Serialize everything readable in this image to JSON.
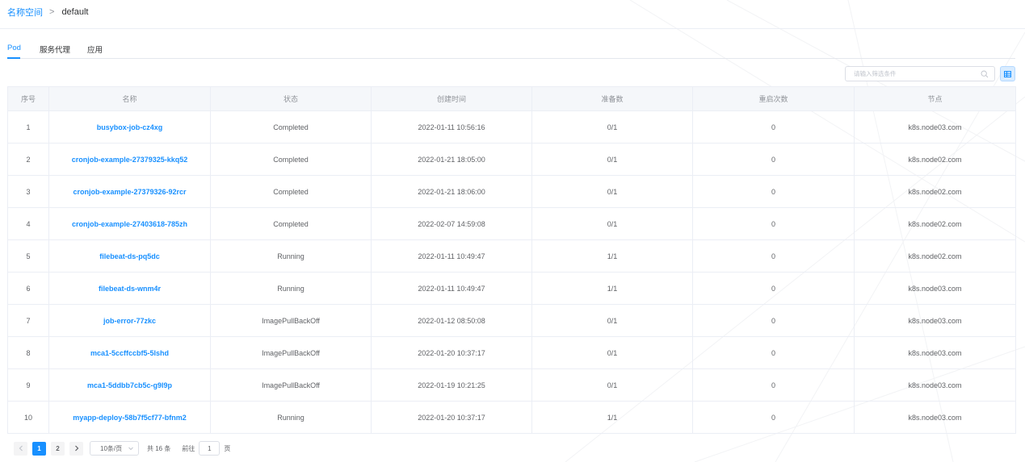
{
  "breadcrumb": {
    "root": "名称空间",
    "separator": ">",
    "current": "default"
  },
  "tabs": [
    {
      "label": "Pod",
      "active": true
    },
    {
      "label": "服务代理",
      "active": false
    },
    {
      "label": "应用",
      "active": false
    }
  ],
  "search": {
    "placeholder": "请输入筛选条件",
    "value": ""
  },
  "colors": {
    "accent": "#1890ff",
    "header_bg": "#f5f7fa",
    "border": "#ebeef5"
  },
  "table": {
    "columns": [
      "序号",
      "名称",
      "状态",
      "创建时间",
      "准备数",
      "重启次数",
      "节点"
    ],
    "rows": [
      [
        "1",
        "busybox-job-cz4xg",
        "Completed",
        "2022-01-11 10:56:16",
        "0/1",
        "0",
        "k8s.node03.com"
      ],
      [
        "2",
        "cronjob-example-27379325-kkq52",
        "Completed",
        "2022-01-21 18:05:00",
        "0/1",
        "0",
        "k8s.node02.com"
      ],
      [
        "3",
        "cronjob-example-27379326-92rcr",
        "Completed",
        "2022-01-21 18:06:00",
        "0/1",
        "0",
        "k8s.node02.com"
      ],
      [
        "4",
        "cronjob-example-27403618-785zh",
        "Completed",
        "2022-02-07 14:59:08",
        "0/1",
        "0",
        "k8s.node02.com"
      ],
      [
        "5",
        "filebeat-ds-pq5dc",
        "Running",
        "2022-01-11 10:49:47",
        "1/1",
        "0",
        "k8s.node02.com"
      ],
      [
        "6",
        "filebeat-ds-wnm4r",
        "Running",
        "2022-01-11 10:49:47",
        "1/1",
        "0",
        "k8s.node03.com"
      ],
      [
        "7",
        "job-error-77zkc",
        "ImagePullBackOff",
        "2022-01-12 08:50:08",
        "0/1",
        "0",
        "k8s.node03.com"
      ],
      [
        "8",
        "mca1-5ccffccbf5-5lshd",
        "ImagePullBackOff",
        "2022-01-20 10:37:17",
        "0/1",
        "0",
        "k8s.node03.com"
      ],
      [
        "9",
        "mca1-5ddbb7cb5c-g9l9p",
        "ImagePullBackOff",
        "2022-01-19 10:21:25",
        "0/1",
        "0",
        "k8s.node03.com"
      ],
      [
        "10",
        "myapp-deploy-58b7f5cf77-bfnm2",
        "Running",
        "2022-01-20 10:37:17",
        "1/1",
        "0",
        "k8s.node03.com"
      ]
    ]
  },
  "pagination": {
    "pages": [
      "1",
      "2"
    ],
    "current_page": "1",
    "page_size": "10条/页",
    "total_text": "共 16 条",
    "goto_label": "前往",
    "goto_value": "1",
    "goto_suffix": "页",
    "prev_icon": "chevron-left-icon",
    "next_icon": "chevron-right-icon"
  }
}
